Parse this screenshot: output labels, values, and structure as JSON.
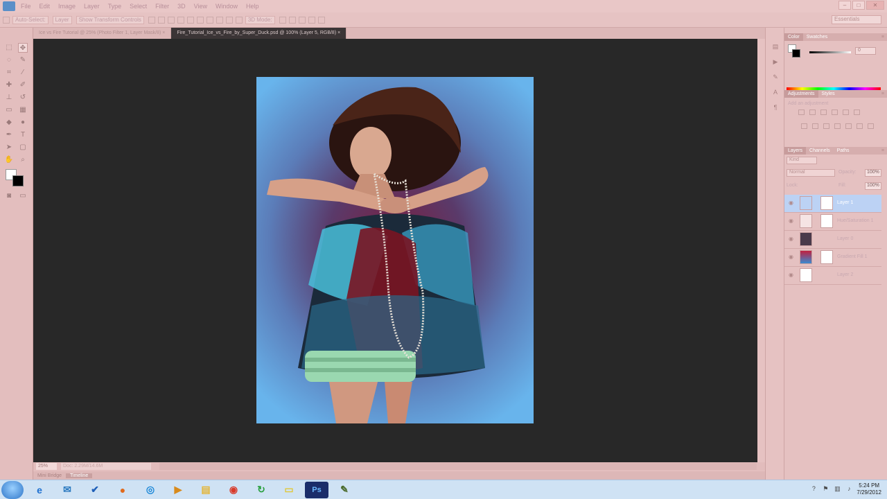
{
  "menubar": {
    "items": [
      "File",
      "Edit",
      "Image",
      "Layer",
      "Type",
      "Select",
      "Filter",
      "3D",
      "View",
      "Window",
      "Help"
    ],
    "window_controls": [
      "–",
      "□",
      "✕"
    ]
  },
  "optbar": {
    "auto_select_label": "Auto-Select:",
    "auto_select_value": "Layer",
    "show_transform_label": "Show Transform Controls",
    "mode_label": "3D Mode:",
    "workspace": "Essentials"
  },
  "doc_tabs": [
    {
      "label": "Ice vs Fire Tutorial @ 25% (Photo Filter 1, Layer Mask/8) ×"
    },
    {
      "label": "Fire_Tutorial_Ice_vs_Fire_by_Super_Duck.psd @ 100% (Layer 5, RGB/8) ×"
    }
  ],
  "status": {
    "zoom": "25%",
    "doc_info": "Doc: 2.29M/14.6M"
  },
  "bottom_tabs": [
    "Mini Bridge",
    "Timeline"
  ],
  "panels": {
    "color_tabs": [
      "Color",
      "Swatches"
    ],
    "color_value": "0",
    "adjust_tabs": [
      "Adjustments",
      "Styles"
    ],
    "adjust_hint": "Add an adjustment",
    "layer_tabs": [
      "Layers",
      "Channels",
      "Paths"
    ],
    "kind_label": "Kind",
    "blend_mode": "Normal",
    "opacity_label": "Opacity:",
    "opacity_value": "100%",
    "lock_label": "Lock:",
    "fill_label": "Fill:",
    "fill_value": "100%",
    "layers": [
      {
        "name": "Layer 1",
        "selected": true
      },
      {
        "name": "Hue/Saturation 1",
        "selected": false
      },
      {
        "name": "Layer 0",
        "selected": false
      },
      {
        "name": "Gradient Fill 1",
        "selected": false
      },
      {
        "name": "Layer 2",
        "selected": false
      }
    ]
  },
  "taskbar": {
    "apps": [
      {
        "name": "ie-icon",
        "glyph": "e",
        "color": "#1c6fd0"
      },
      {
        "name": "wlm-icon",
        "glyph": "✉",
        "color": "#2c7ac0"
      },
      {
        "name": "task-icon",
        "glyph": "✔",
        "color": "#1f5fb8"
      },
      {
        "name": "firefox-icon",
        "glyph": "●",
        "color": "#e06a1c"
      },
      {
        "name": "safari-icon",
        "glyph": "◎",
        "color": "#1c88d8"
      },
      {
        "name": "media-icon",
        "glyph": "▶",
        "color": "#d88a1c"
      },
      {
        "name": "folder-icon",
        "glyph": "▤",
        "color": "#e4b63a"
      },
      {
        "name": "chrome-icon",
        "glyph": "◉",
        "color": "#d83a2a"
      },
      {
        "name": "upload-icon",
        "glyph": "↻",
        "color": "#2aa040"
      },
      {
        "name": "notes-icon",
        "glyph": "▭",
        "color": "#e0c83a"
      },
      {
        "name": "photoshop-icon",
        "glyph": "Ps",
        "color": "#1a2d6a"
      },
      {
        "name": "script-icon",
        "glyph": "✎",
        "color": "#4a6a2a"
      }
    ],
    "clock_time": "5:24 PM",
    "clock_date": "7/29/2012"
  }
}
